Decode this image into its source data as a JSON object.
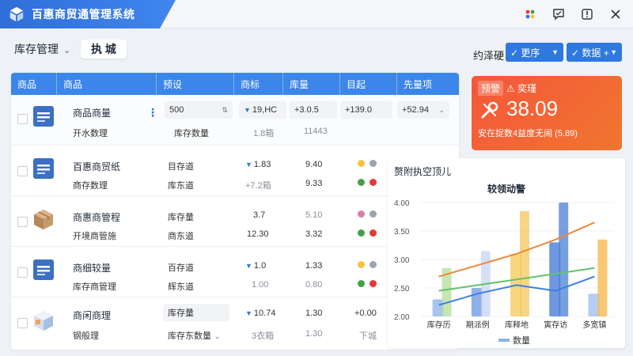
{
  "app": {
    "title": "百惠商贸通管理系统"
  },
  "window_icons": [
    "apps-icon",
    "chat-icon",
    "info-icon",
    "close-icon"
  ],
  "toolbar": {
    "module": "库存管理",
    "search_text": "执 城",
    "filter_label": "约泽硬",
    "chip1": "✓ 更序",
    "chip2": "✓ 数据 +"
  },
  "table": {
    "headers": [
      "商品",
      "商品",
      "预设",
      "商标",
      "库量",
      "目起",
      "先量项"
    ],
    "rows": [
      {
        "icon": "document-icon",
        "name": "商品商量",
        "sub": "开水数理",
        "c1": "500",
        "c1_sub": "库存数量",
        "c2": "19,HC",
        "c2_sub": "1.8箱",
        "c3": "+3.0.5",
        "c3_sub": "11443",
        "c4": "+139.0",
        "c5": "+52.94",
        "c2_arrow": true
      },
      {
        "icon": "document-icon",
        "name": "百惠商贸纸",
        "sub": "商存数理",
        "c1": "目存道",
        "c1_sub": "库东道",
        "c2": "1.83",
        "c2_sub": "+7.2箱",
        "c3": "9.40",
        "c3_sub": "9.33",
        "c2_arrow": true,
        "dots_top": [
          "#f3c43b",
          "#9aa4b2"
        ],
        "dots_bot": [
          "#43a047",
          "#e53935"
        ]
      },
      {
        "icon": "box-icon",
        "name": "商惠商管程",
        "sub": "开境商管施",
        "c1": "库存量",
        "c1_sub": "商东道",
        "c2": "3.7",
        "c2_sub": "12.30",
        "c3": "5.10",
        "c3_sub": "3.32",
        "c2_arrow": false,
        "dots_top": [
          "#e07ab0",
          "#9aa4b2"
        ],
        "dots_bot": [
          "#43a047",
          "#e53935"
        ]
      },
      {
        "icon": "document-icon",
        "name": "商细较量",
        "sub": "库存商管理",
        "c1": "百存道",
        "c1_sub": "辉东道",
        "c2": "1.0",
        "c2_sub": "1.00",
        "c3": "1.33",
        "c3_sub": "0.80",
        "c2_arrow": true,
        "dots_top": [
          "#f3c43b",
          "#9aa4b2"
        ],
        "dots_bot": [
          "#43a047",
          "#e53935"
        ]
      },
      {
        "icon": "cube-icon",
        "name": "商闲商理",
        "sub": "钢般理",
        "c1": "库存量",
        "c1_sub": "库存东数量",
        "c2": "10.74",
        "c2_sub": "3衣箱",
        "c3": "1.30",
        "c3_sub": "1.30",
        "c4": "+0.00",
        "c4_sub": "下城",
        "c2_arrow": true
      }
    ]
  },
  "alert": {
    "tag": "预警",
    "tag2": "⚠ 奕瑾",
    "value": "38.09",
    "sub": "安在捉数4益度无闹 (5.89)"
  },
  "chart_card": {
    "header": "赘附执空顶儿"
  },
  "chart_data": {
    "type": "bar",
    "title": "较领动警",
    "categories": [
      "库存历",
      "期派例",
      "库释地",
      "寅存访",
      "多宽镇"
    ],
    "ylim": [
      2.0,
      4.0
    ],
    "yticks": [
      "2.00",
      "2.50",
      "3.00",
      "3.50",
      "4.00"
    ],
    "series": [
      {
        "name": "数量",
        "values": [
          2.3,
          2.5,
          3.1,
          3.3,
          2.4
        ]
      }
    ],
    "lines": [
      {
        "values": [
          2.7,
          2.9,
          3.1,
          3.35,
          3.65
        ]
      },
      {
        "values": [
          2.45,
          2.55,
          2.65,
          2.75,
          2.85
        ]
      },
      {
        "values": [
          2.2,
          2.4,
          2.55,
          2.45,
          2.7
        ]
      }
    ],
    "legend": "数量"
  }
}
